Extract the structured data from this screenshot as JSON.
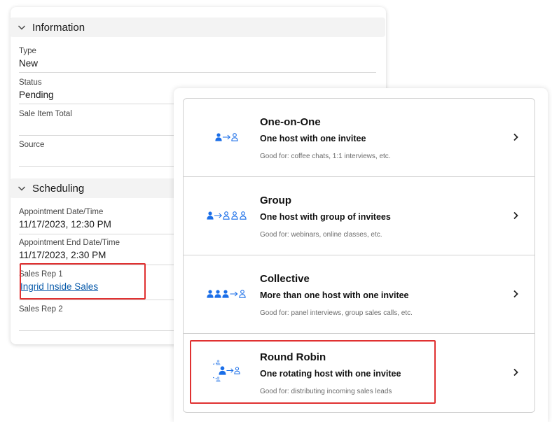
{
  "information": {
    "header": "Information",
    "fields": [
      {
        "label": "Type",
        "value": "New"
      },
      {
        "label": "Status",
        "value": "Pending"
      },
      {
        "label": "Sale Item Total",
        "value": ""
      },
      {
        "label": "Source",
        "value": ""
      }
    ]
  },
  "scheduling": {
    "header": "Scheduling",
    "fields": [
      {
        "label": "Appointment Date/Time",
        "value": "11/17/2023, 12:30 PM"
      },
      {
        "label": "Appointment End Date/Time",
        "value": "11/17/2023, 2:30 PM"
      },
      {
        "label": "Sales Rep 1",
        "value": "Ingrid Inside Sales"
      },
      {
        "label": "Sales Rep 2",
        "value": ""
      }
    ]
  },
  "event_types": [
    {
      "title": "One-on-One",
      "subtitle": "One host with one invitee",
      "good_for": "Good for: coffee chats, 1:1 interviews, etc.",
      "icon": "one-on-one-icon"
    },
    {
      "title": "Group",
      "subtitle": "One host with group of invitees",
      "good_for": "Good for: webinars, online classes, etc.",
      "icon": "group-icon"
    },
    {
      "title": "Collective",
      "subtitle": "More than one host with one invitee",
      "good_for": "Good for: panel interviews, group sales calls, etc.",
      "icon": "collective-icon"
    },
    {
      "title": "Round Robin",
      "subtitle": "One rotating host with one invitee",
      "good_for": "Good for: distributing incoming sales leads",
      "icon": "round-robin-icon"
    }
  ],
  "colors": {
    "accent_blue": "#0b5cab",
    "icon_blue": "#1a6ee8",
    "highlight_red": "#e03131"
  }
}
